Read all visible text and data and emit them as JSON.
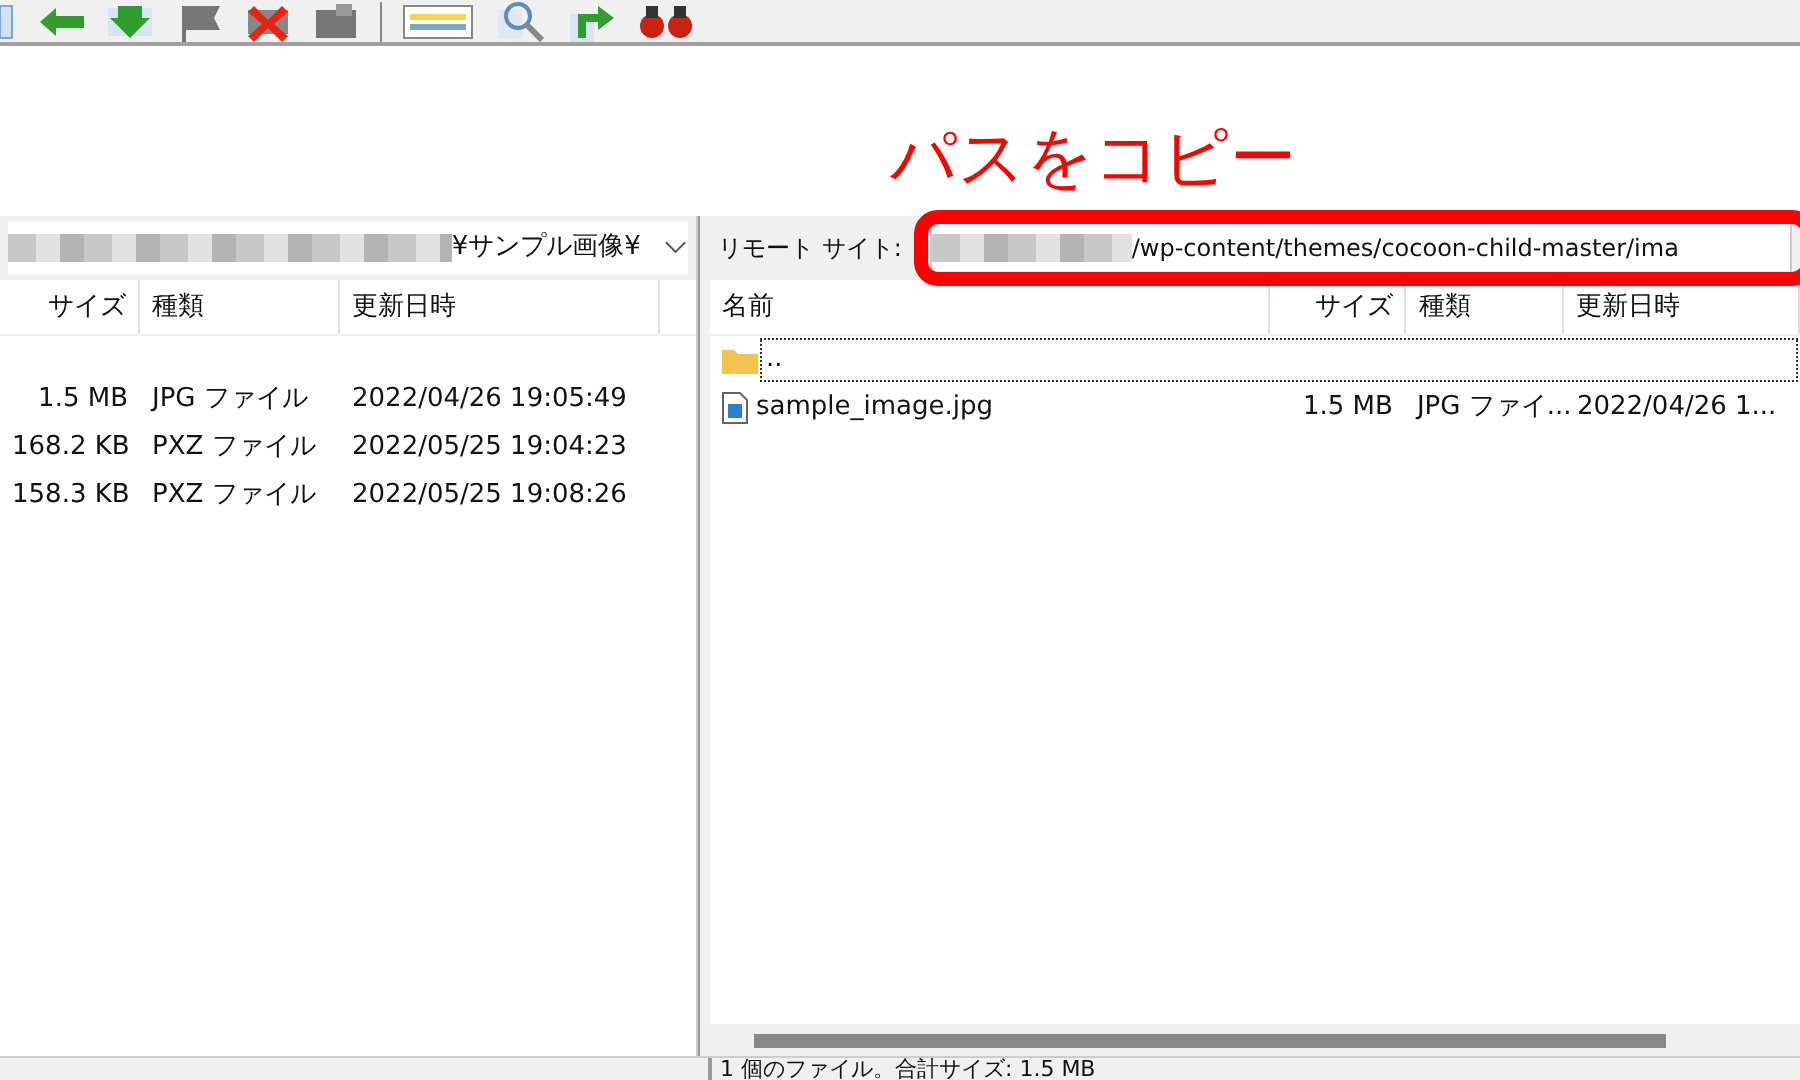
{
  "annotation": {
    "label": "パスをコピー"
  },
  "local": {
    "path_suffix": "¥サンプル画像¥",
    "columns": [
      "サイズ",
      "種類",
      "更新日時"
    ],
    "rows": [
      {
        "size": "1.5 MB",
        "type": "JPG ファイル",
        "modified": "2022/04/26 19:05:49"
      },
      {
        "size": "168.2 KB",
        "type": "PXZ ファイル",
        "modified": "2022/05/25 19:04:23"
      },
      {
        "size": "158.3 KB",
        "type": "PXZ ファイル",
        "modified": "2022/05/25 19:08:26"
      }
    ]
  },
  "remote": {
    "label": "リモート サイト:",
    "path_suffix": "/wp-content/themes/cocoon-child-master/ima",
    "columns": [
      "名前",
      "サイズ",
      "種類",
      "更新日時"
    ],
    "rows": [
      {
        "kind": "folder",
        "name": "..",
        "size": "",
        "type": "",
        "modified": ""
      },
      {
        "kind": "file",
        "name": "sample_image.jpg",
        "size": "1.5 MB",
        "type": "JPG ファイ...",
        "modified": "2022/04/26 1..."
      }
    ],
    "status": "1 個のファイル。合計サイズ: 1.5 MB"
  }
}
